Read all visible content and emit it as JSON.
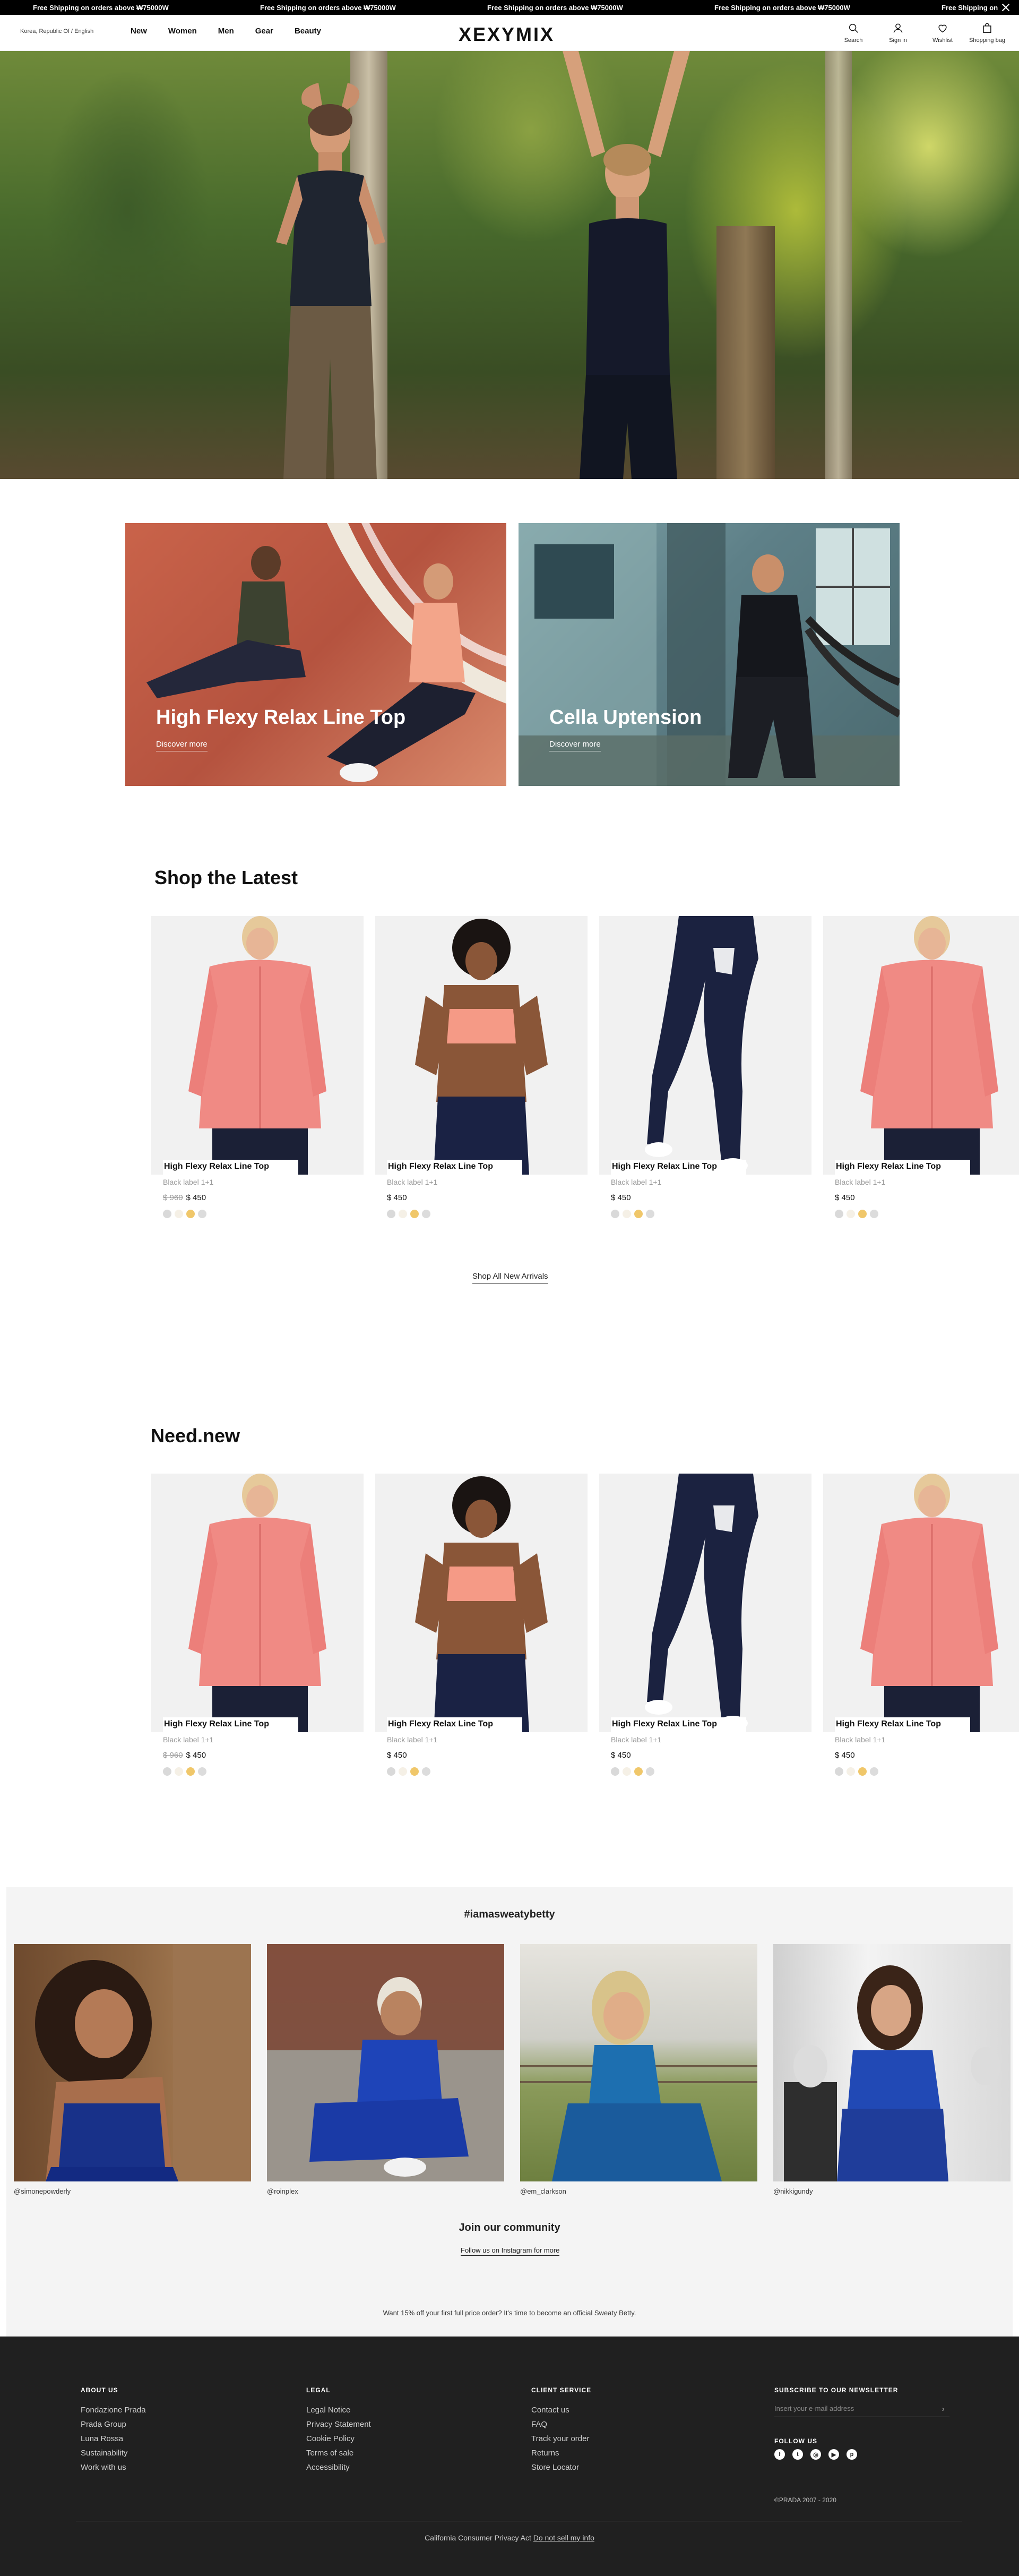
{
  "announcement": {
    "messages": [
      "Free Shipping on orders above ₩75000W",
      "Free Shipping on orders above ₩75000W",
      "Free Shipping on orders above ₩75000W",
      "Free Shipping on orders above ₩75000W",
      "Free Shipping on"
    ]
  },
  "header": {
    "region": "Korea, Republic Of / English",
    "nav": [
      "New",
      "Women",
      "Men",
      "Gear",
      "Beauty"
    ],
    "logo": "XEXYMIX",
    "icons": [
      {
        "label": "Search",
        "icon": "search-icon"
      },
      {
        "label": "Sign in",
        "icon": "user-icon"
      },
      {
        "label": "Wishlist",
        "icon": "heart-icon"
      },
      {
        "label": "Shopping bag",
        "icon": "bag-icon"
      }
    ]
  },
  "promos": [
    {
      "title": "High Flexy Relax Line Top",
      "cta": "Discover more"
    },
    {
      "title": "Cella Uptension",
      "cta": "Discover more"
    }
  ],
  "latest": {
    "title": "Shop the Latest",
    "products": [
      {
        "name": "High Flexy Relax Line Top",
        "sub": "Black label 1+1",
        "old_price": "$ 960",
        "price": "$ 450",
        "image": "pink-jacket"
      },
      {
        "name": "High Flexy Relax Line Top",
        "sub": "Black label 1+1",
        "old_price": "",
        "price": "$ 450",
        "image": "pink-sports-bra"
      },
      {
        "name": "High Flexy Relax Line Top",
        "sub": "Black label 1+1",
        "old_price": "",
        "price": "$ 450",
        "image": "navy-leggings"
      },
      {
        "name": "High Flexy Relax Line Top",
        "sub": "Black label 1+1",
        "old_price": "",
        "price": "$ 450",
        "image": "pink-jacket"
      }
    ],
    "shop_all": "Shop All New Arrivals"
  },
  "need_new": {
    "title": "Need.new",
    "products": [
      {
        "name": "High Flexy Relax Line Top",
        "sub": "Black label 1+1",
        "old_price": "$ 960",
        "price": "$ 450",
        "image": "pink-jacket"
      },
      {
        "name": "High Flexy Relax Line Top",
        "sub": "Black label 1+1",
        "old_price": "",
        "price": "$ 450",
        "image": "pink-sports-bra"
      },
      {
        "name": "High Flexy Relax Line Top",
        "sub": "Black label 1+1",
        "old_price": "",
        "price": "$ 450",
        "image": "navy-leggings"
      },
      {
        "name": "High Flexy Relax Line Top",
        "sub": "Black label 1+1",
        "old_price": "",
        "price": "$ 450",
        "image": "pink-jacket"
      }
    ]
  },
  "swatch_colors": [
    "#d9d9d9",
    "#f5f0e6",
    "#f0c76a",
    "#dcdcdc"
  ],
  "community": {
    "hashtag": "#iamasweatybetty",
    "posts": [
      {
        "handle": "@simonepowderly"
      },
      {
        "handle": "@roinplex"
      },
      {
        "handle": "@em_clarkson"
      },
      {
        "handle": "@nikkigundy"
      }
    ],
    "join_title": "Join our community",
    "follow_link": "Follow us on Instagram for more",
    "promo_text": "Want 15% off your first full price order? It's time to become an official Sweaty Betty."
  },
  "footer": {
    "about": {
      "heading": "ABOUT US",
      "links": [
        "Fondazione Prada",
        "Prada Group",
        "Luna Rossa",
        "Sustainability",
        "Work with us"
      ]
    },
    "legal": {
      "heading": "LEGAL",
      "links": [
        "Legal Notice",
        "Privacy Statement",
        "Cookie Policy",
        "Terms of sale",
        "Accessibility"
      ]
    },
    "client": {
      "heading": "CLIENT SERVICE",
      "links": [
        "Contact us",
        "FAQ",
        "Track your order",
        "Returns",
        "Store Locator"
      ]
    },
    "newsletter": {
      "heading": "SUBSCRIBE TO OUR NEWSLETTER",
      "placeholder": "Insert your e-mail address",
      "arrow": "›"
    },
    "follow_heading": "FOLLOW US",
    "social": [
      {
        "icon": "facebook-icon",
        "glyph": "f"
      },
      {
        "icon": "twitter-icon",
        "glyph": "t"
      },
      {
        "icon": "instagram-icon",
        "glyph": "◎"
      },
      {
        "icon": "youtube-icon",
        "glyph": "▶"
      },
      {
        "icon": "pinterest-icon",
        "glyph": "p"
      }
    ],
    "copyright": "©PRADA 2007 - 2020",
    "ccpa_text": "California Consumer Privacy Act",
    "ccpa_link": "Do not sell my info"
  }
}
